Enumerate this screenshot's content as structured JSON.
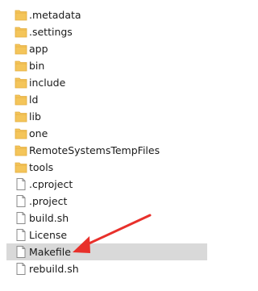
{
  "colors": {
    "folder": "#f4c55a",
    "folder_dark": "#e2ac3f",
    "file_border": "#8a8a8a",
    "selection": "#d9d9d9",
    "arrow": "#e8302b"
  },
  "items": [
    {
      "label": ".metadata",
      "icon": "folder-icon",
      "selected": false
    },
    {
      "label": ".settings",
      "icon": "folder-icon",
      "selected": false
    },
    {
      "label": "app",
      "icon": "folder-icon",
      "selected": false
    },
    {
      "label": "bin",
      "icon": "folder-icon",
      "selected": false
    },
    {
      "label": "include",
      "icon": "folder-icon",
      "selected": false
    },
    {
      "label": "ld",
      "icon": "folder-icon",
      "selected": false
    },
    {
      "label": "lib",
      "icon": "folder-icon",
      "selected": false
    },
    {
      "label": "one",
      "icon": "folder-icon",
      "selected": false
    },
    {
      "label": "RemoteSystemsTempFiles",
      "icon": "folder-icon",
      "selected": false
    },
    {
      "label": "tools",
      "icon": "folder-icon",
      "selected": false
    },
    {
      "label": ".cproject",
      "icon": "file-icon",
      "selected": false
    },
    {
      "label": ".project",
      "icon": "file-icon",
      "selected": false
    },
    {
      "label": "build.sh",
      "icon": "file-icon",
      "selected": false
    },
    {
      "label": "License",
      "icon": "file-icon",
      "selected": false
    },
    {
      "label": "Makefile",
      "icon": "file-icon",
      "selected": true
    },
    {
      "label": "rebuild.sh",
      "icon": "file-icon",
      "selected": false
    }
  ]
}
